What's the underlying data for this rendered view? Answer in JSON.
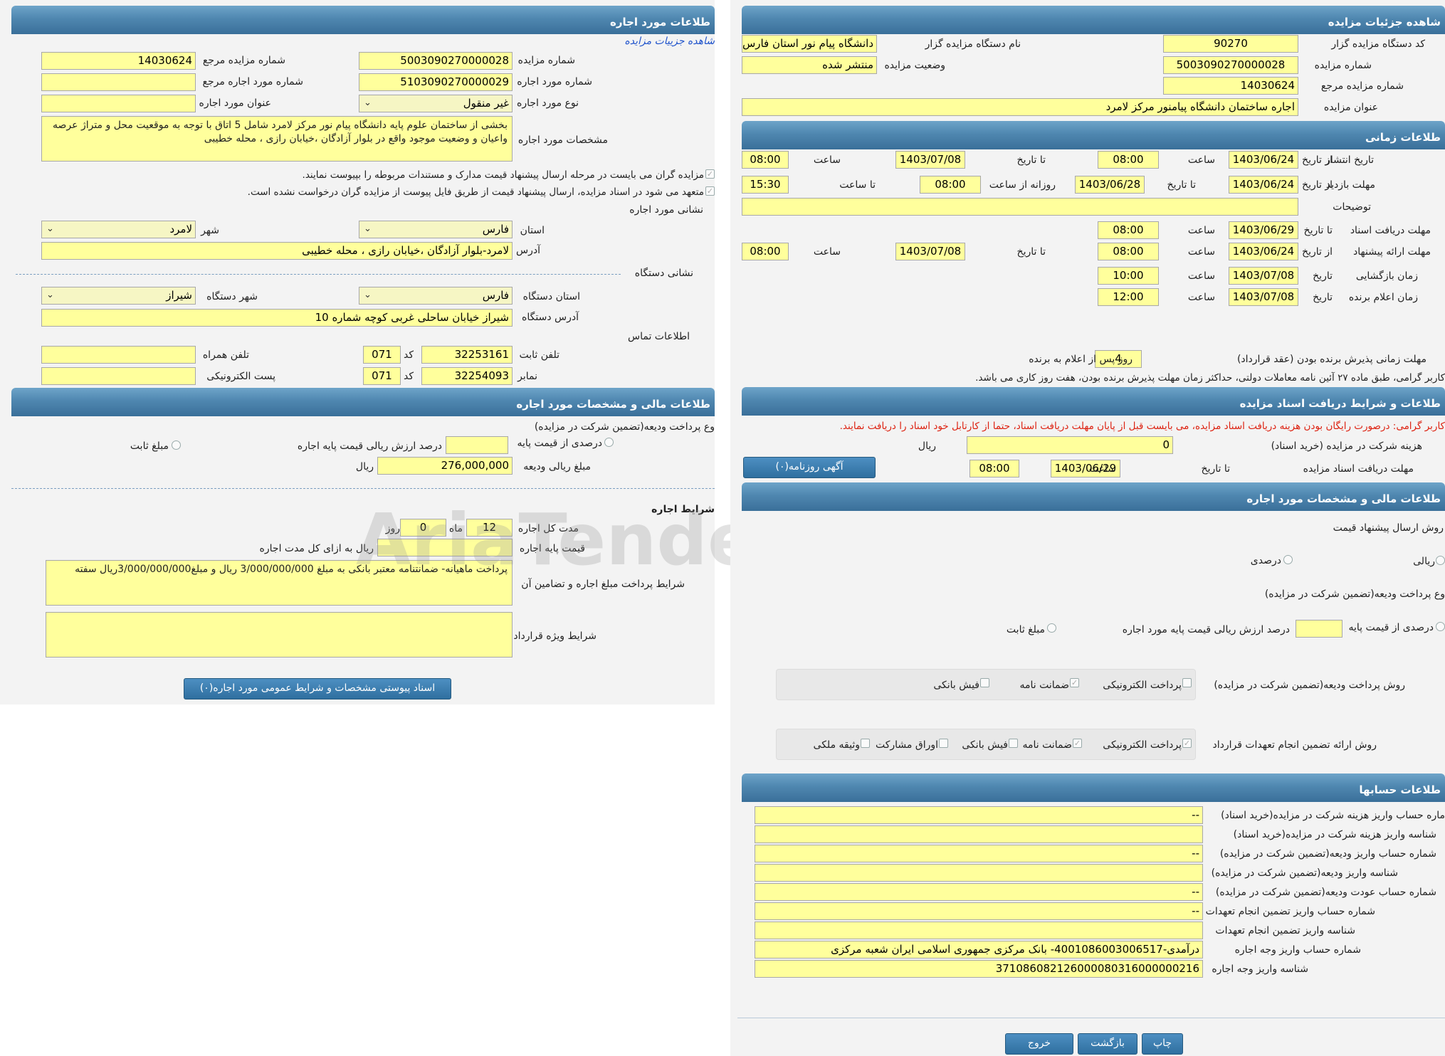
{
  "left": {
    "headers": {
      "lease_info": "طلاعات مورد اجاره",
      "financial": "طلاعات مالی و مشخصات مورد اجاره"
    },
    "view_details_link": "شاهده جزییات مزایده",
    "labels": {
      "auction_number": "شماره مزایده",
      "ref_auction_number": "شماره مزایده مرجع",
      "lease_item_number": "شماره مورد اجاره",
      "ref_lease_number": "شماره مورد اجاره مرجع",
      "lease_item_type": "نوع مورد اجاره",
      "lease_item_title": "عنوان مورد اجاره",
      "lease_specs": "مشخصات مورد اجاره",
      "province": "استان",
      "city": "شهر",
      "address": "آدرس",
      "device_address_section": "نشانی دستگاه",
      "device_province": "استان دستگاه",
      "device_city": "شهر دستگاه",
      "device_address": "آدرس دستگاه",
      "contact_section": "اطلاعات تماس",
      "phone": "تلفن ثابت",
      "code": "کد",
      "mobile": "تلفن همراه",
      "fax": "نمابر",
      "email": "پست الکترونیکی",
      "location_section": "نشانی مورد اجاره",
      "deposit_type": "وع پرداخت ودیعه(تضمین شرکت در مزایده)",
      "percent_base": "درصدی از قیمت پایه",
      "percent_value": "درصد ارزش ریالی قیمت پایه اجاره",
      "fixed_amount": "مبلغ ثابت",
      "deposit_amount": "مبلغ ریالی ودیعه",
      "rial": "ریال",
      "lease_terms": "شرایط اجاره",
      "total_duration": "مدت کل اجاره",
      "month": "ماه",
      "day": "روز",
      "base_price": "قیمت پایه اجاره",
      "base_price_note": "ریال به ازای کل مدت اجاره",
      "payment_terms": "شرایط پرداخت مبلغ اجاره و تضامین آن",
      "special_terms": "شرایط ویژه قرارداد"
    },
    "values": {
      "auction_number": "5003090270000028",
      "ref_auction_number": "14030624",
      "lease_item_number": "5103090270000029",
      "ref_lease_number": "",
      "lease_item_type": "غیر منقول",
      "lease_item_title": "",
      "lease_specs": "بخشی از ساختمان علوم پایه دانشگاه پیام نور مرکز لامرد شامل 5 اتاق با توجه به موقعیت محل و متراژ عرصه واعیان  و  وضعیت موجود  واقع در  بلوار آزادگان ،خیابان رازی ، محله خطیبی",
      "province": "فارس",
      "city": "لامرد",
      "address": "لامرد-بلوار آزادگان ،خیابان رازی ، محله خطیبی",
      "device_province": "فارس",
      "device_city": "شیراز",
      "device_address": "شیراز خیابان ساحلی غربی کوچه شماره 10",
      "phone": "32253161",
      "phone_code": "071",
      "mobile": "",
      "fax": "32254093",
      "fax_code": "071",
      "email": "",
      "percent_value": "",
      "deposit_amount": "276,000,000",
      "duration_month": "12",
      "duration_days": "0",
      "duration_month_b": "",
      "base_price": "",
      "payment_terms": "پرداخت ماهیانه- ضمانتنامه معتبر بانکی به مبلغ 3/000/000/000 ریال و مبلغ3/000/000/000ریال سفته",
      "special_terms": ""
    },
    "checks": {
      "docs_note": "مزایده گران می بایست در مرحله ارسال پیشنهاد قیمت مدارک و مستندات مربوطه را بپیوست نمایند.",
      "commit_note": "متعهد می شود در اسناد مزایده، ارسال پیشنهاد قیمت از طریق فایل پیوست از مزایده گران درخواست نشده است."
    },
    "attach_button": "اسناد پیوستی مشخصات و شرایط عمومی مورد اجاره(۰)"
  },
  "right": {
    "headers": {
      "details": "شاهده جزئیات مزایده",
      "time": "طلاعات زمانی",
      "docs": "طلاعات و شرایط دریافت اسناد مزایده",
      "financial": "طلاعات مالی و مشخصات مورد اجاره",
      "accounts": "طلاعات حسابها"
    },
    "labels": {
      "org_code": "کد دستگاه مزایده گزار",
      "org_name": "نام دستگاه مزایده گزار",
      "auction_number": "شماره مزایده",
      "status": "وضعیت مزایده",
      "ref_number": "شماره مزایده مرجع",
      "title": "عنوان مزایده",
      "publish_date": "تاریخ انتشار",
      "visit_deadline": "مهلت بازدید",
      "description": "توضیحات",
      "doc_deadline": "مهلت دریافت اسناد",
      "offer_deadline": "مهلت ارائه پیشنهاد",
      "opening_time": "زمان بازگشایی",
      "winner_time": "زمان اعلام برنده",
      "from_date": "از تاریخ",
      "to_date": "تا تاریخ",
      "date": "تاریخ",
      "time": "ساعت",
      "to_time": "تا ساعت",
      "daily_from": "روزانه از ساعت",
      "accept_deadline": "مهلت زمانی پذیرش برنده بودن (عقد قرارداد)",
      "accept_days_suffix": "روز پس از اعلام به برنده",
      "doc_fee": "هزینه شرکت در مزایده (خرید اسناد)",
      "rial": "ریال",
      "doc_receive_deadline": "مهلت دریافت اسناد مزایده",
      "offer_method": "روش ارسال پیشنهاد قیمت",
      "rial_option": "ریالی",
      "percent_option": "درصدی",
      "deposit_type": "وع پرداخت ودیعه(تضمین شرکت در مزایده)",
      "percent_base": "درصدی از قیمت پایه",
      "percent_value": "درصد ارزش ریالی قیمت پایه مورد اجاره",
      "fixed_amount": "مبلغ ثابت",
      "deposit_method": "روش پرداخت ودیعه(تضمین شرکت در مزایده)",
      "guarantee_method": "روش ارائه تضمین انجام تعهدات قرارداد",
      "electronic": "پرداخت الکترونیکی",
      "guarantee_letter": "ضمانت نامه",
      "bank_receipt": "فیش بانکی",
      "participation_papers": "اوراق مشارکت",
      "property_collateral": "وثیقه ملکی",
      "acc1": "ماره حساب واریز هزینه شرکت در مزایده(خرید اسناد)",
      "acc2": "شناسه واریز هزینه شرکت در مزایده(خرید اسناد)",
      "acc3": "شماره حساب واریز ودیعه(تضمین شرکت در مزایده)",
      "acc4": "شناسه واریز ودیعه(تضمین شرکت در مزایده)",
      "acc5": "شماره حساب عودت ودیعه(تضمین شرکت در مزایده)",
      "acc6": "شماره حساب واریز تضمین انجام تعهدات",
      "acc7": "شناسه واریز تضمین انجام تعهدات",
      "acc8": "شماره حساب واریز وجه اجاره",
      "acc9": "شناسه واریز وجه اجاره"
    },
    "values": {
      "org_code": "90270",
      "org_name": "دانشگاه پیام نور استان فارس",
      "auction_number": "5003090270000028",
      "status": "منتشر شده",
      "ref_number": "14030624",
      "title": "اجاره  ساختمان دانشگاه پیامنور  مرکز لامرد",
      "publish_from": "1403/06/24",
      "publish_from_time": "08:00",
      "publish_to": "1403/07/08",
      "publish_to_time": "08:00",
      "visit_from": "1403/06/24",
      "visit_to": "1403/06/28",
      "visit_daily_from": "08:00",
      "visit_to_time": "15:30",
      "description": "",
      "doc_to": "1403/06/29",
      "doc_to_time": "08:00",
      "offer_from": "1403/06/24",
      "offer_from_time": "08:00",
      "offer_to": "1403/07/08",
      "offer_to_time": "08:00",
      "opening_date": "1403/07/08",
      "opening_time": "10:00",
      "winner_date": "1403/07/08",
      "winner_time": "12:00",
      "accept_days": "4",
      "doc_fee": "0",
      "doc_receive_to": "1403/06/29",
      "doc_receive_time": "08:00",
      "percent_value": "",
      "acc1": "--",
      "acc2": "",
      "acc3": "--",
      "acc4": "",
      "acc5": "--",
      "acc6": "--",
      "acc7": "",
      "acc8": "درآمدی-4001086003006517- بانک مرکزی جمهوری اسلامی ایران شعبه مرکزی",
      "acc9": "371086082126000080316000000216"
    },
    "notes": {
      "article27": "کاربر گرامی، طبق ماده ۲۷ آئین نامه معاملات دولتی، حداکثر زمان مهلت پذیرش برنده بودن، هفت روز کاری می باشد.",
      "free_docs": "کاربر گرامی: درصورت رایگان بودن هزینه دریافت اسناد مزایده، می بایست قبل از پایان مهلت دریافت اسناد، حتما از کارتابل خود اسناد را دریافت نمایند."
    },
    "newspaper_button": "آگهی روزنامه(۰)",
    "buttons": {
      "print": "چاپ",
      "back": "بازگشت",
      "exit": "خروج"
    }
  },
  "colors": {
    "header": "#4f87b0",
    "field": "#ffff9c",
    "note_red": "#d21"
  }
}
